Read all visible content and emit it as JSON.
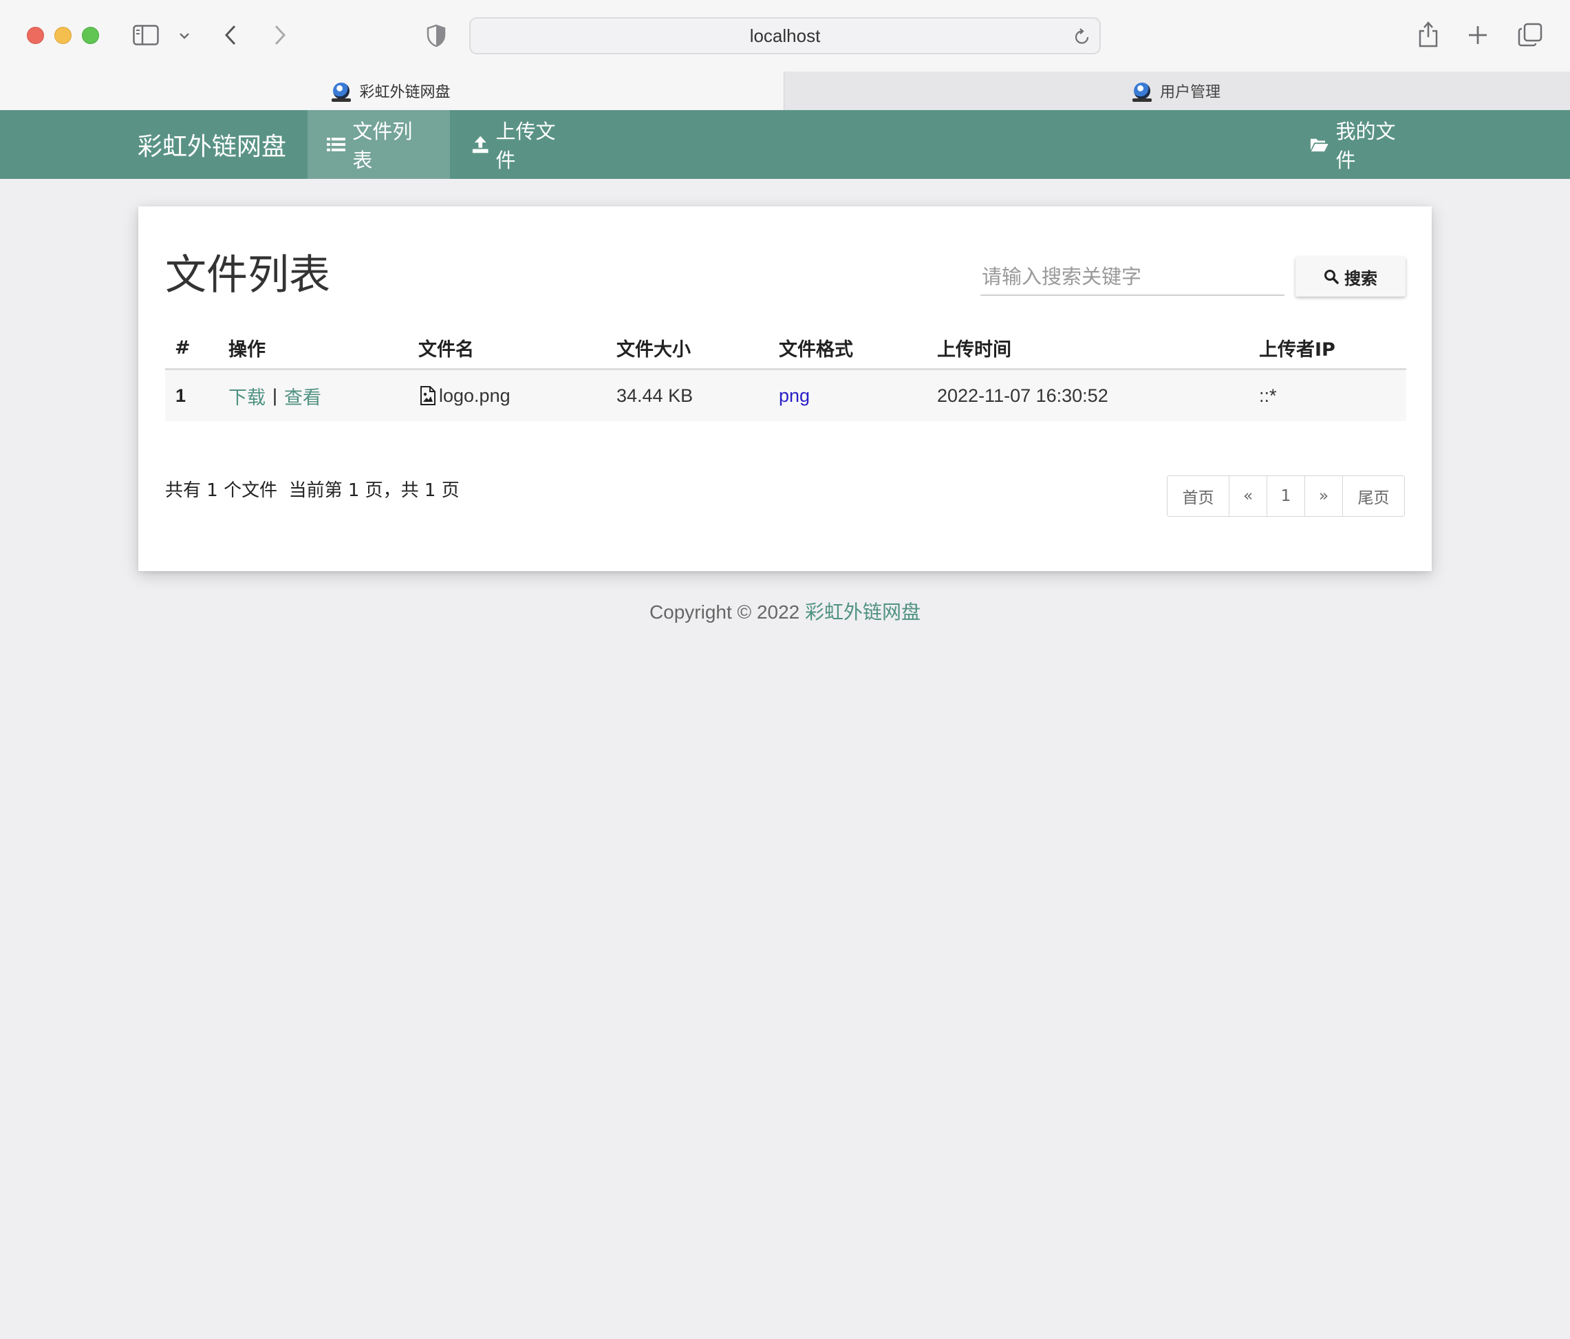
{
  "browser": {
    "url": "localhost",
    "tabs": [
      {
        "title": "彩虹外链网盘"
      },
      {
        "title": "用户管理"
      }
    ]
  },
  "navbar": {
    "brand": "彩虹外链网盘",
    "items": [
      {
        "label": "文件列表",
        "icon": "list-icon"
      },
      {
        "label": "上传文件",
        "icon": "upload-icon"
      }
    ],
    "right_item": {
      "label": "我的文件",
      "icon": "folder-open-icon"
    },
    "color": "#5a9385"
  },
  "main": {
    "title": "文件列表",
    "search": {
      "placeholder": "请输入搜索关键字",
      "button_label": "搜索"
    },
    "table": {
      "columns": [
        "#",
        "操作",
        "文件名",
        "文件大小",
        "文件格式",
        "上传时间",
        "上传者IP"
      ],
      "rows": [
        {
          "index": "1",
          "action_download": "下载",
          "action_separator": "|",
          "action_view": "查看",
          "filename": "logo.png",
          "size": "34.44 KB",
          "format": "png",
          "upload_time": "2022-11-07 16:30:52",
          "uploader_ip": "::*"
        }
      ]
    },
    "summary": "共有 1 个文件  当前第 1 页，共 1 页",
    "pagination": {
      "first": "首页",
      "prev": "«",
      "current": "1",
      "next": "»",
      "last": "尾页"
    }
  },
  "footer": {
    "copyright": "Copyright © 2022",
    "site_name": "彩虹外链网盘"
  }
}
